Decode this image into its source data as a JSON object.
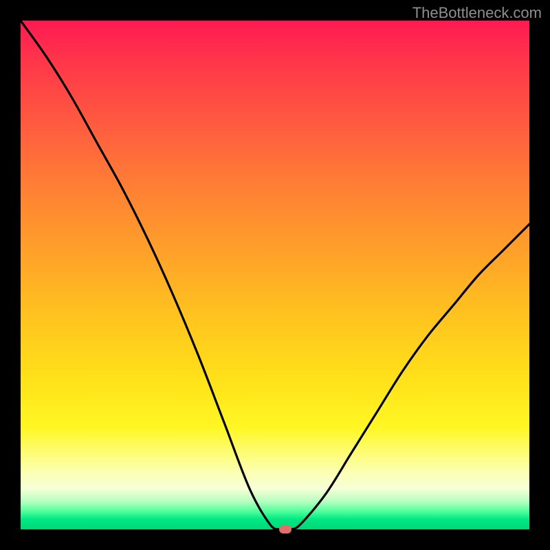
{
  "watermark": "TheBottleneck.com",
  "chart_data": {
    "type": "line",
    "title": "",
    "xlabel": "",
    "ylabel": "",
    "xlim": [
      0,
      100
    ],
    "ylim": [
      0,
      100
    ],
    "grid": false,
    "legend": false,
    "series": [
      {
        "name": "bottleneck-curve",
        "x": [
          0,
          5,
          10,
          15,
          20,
          25,
          30,
          35,
          40,
          45,
          49,
          51,
          53,
          55,
          60,
          65,
          70,
          75,
          80,
          85,
          90,
          95,
          100
        ],
        "y": [
          100,
          93,
          85,
          76,
          67,
          57,
          46,
          34,
          21,
          8,
          1,
          0,
          0,
          1,
          7,
          15,
          23,
          31,
          38,
          44,
          50,
          55,
          60
        ]
      }
    ],
    "marker": {
      "x": 52,
      "y": 0
    },
    "background_gradient": {
      "top": "#ff1a52",
      "mid": "#ffe019",
      "bottom": "#00d876"
    }
  }
}
